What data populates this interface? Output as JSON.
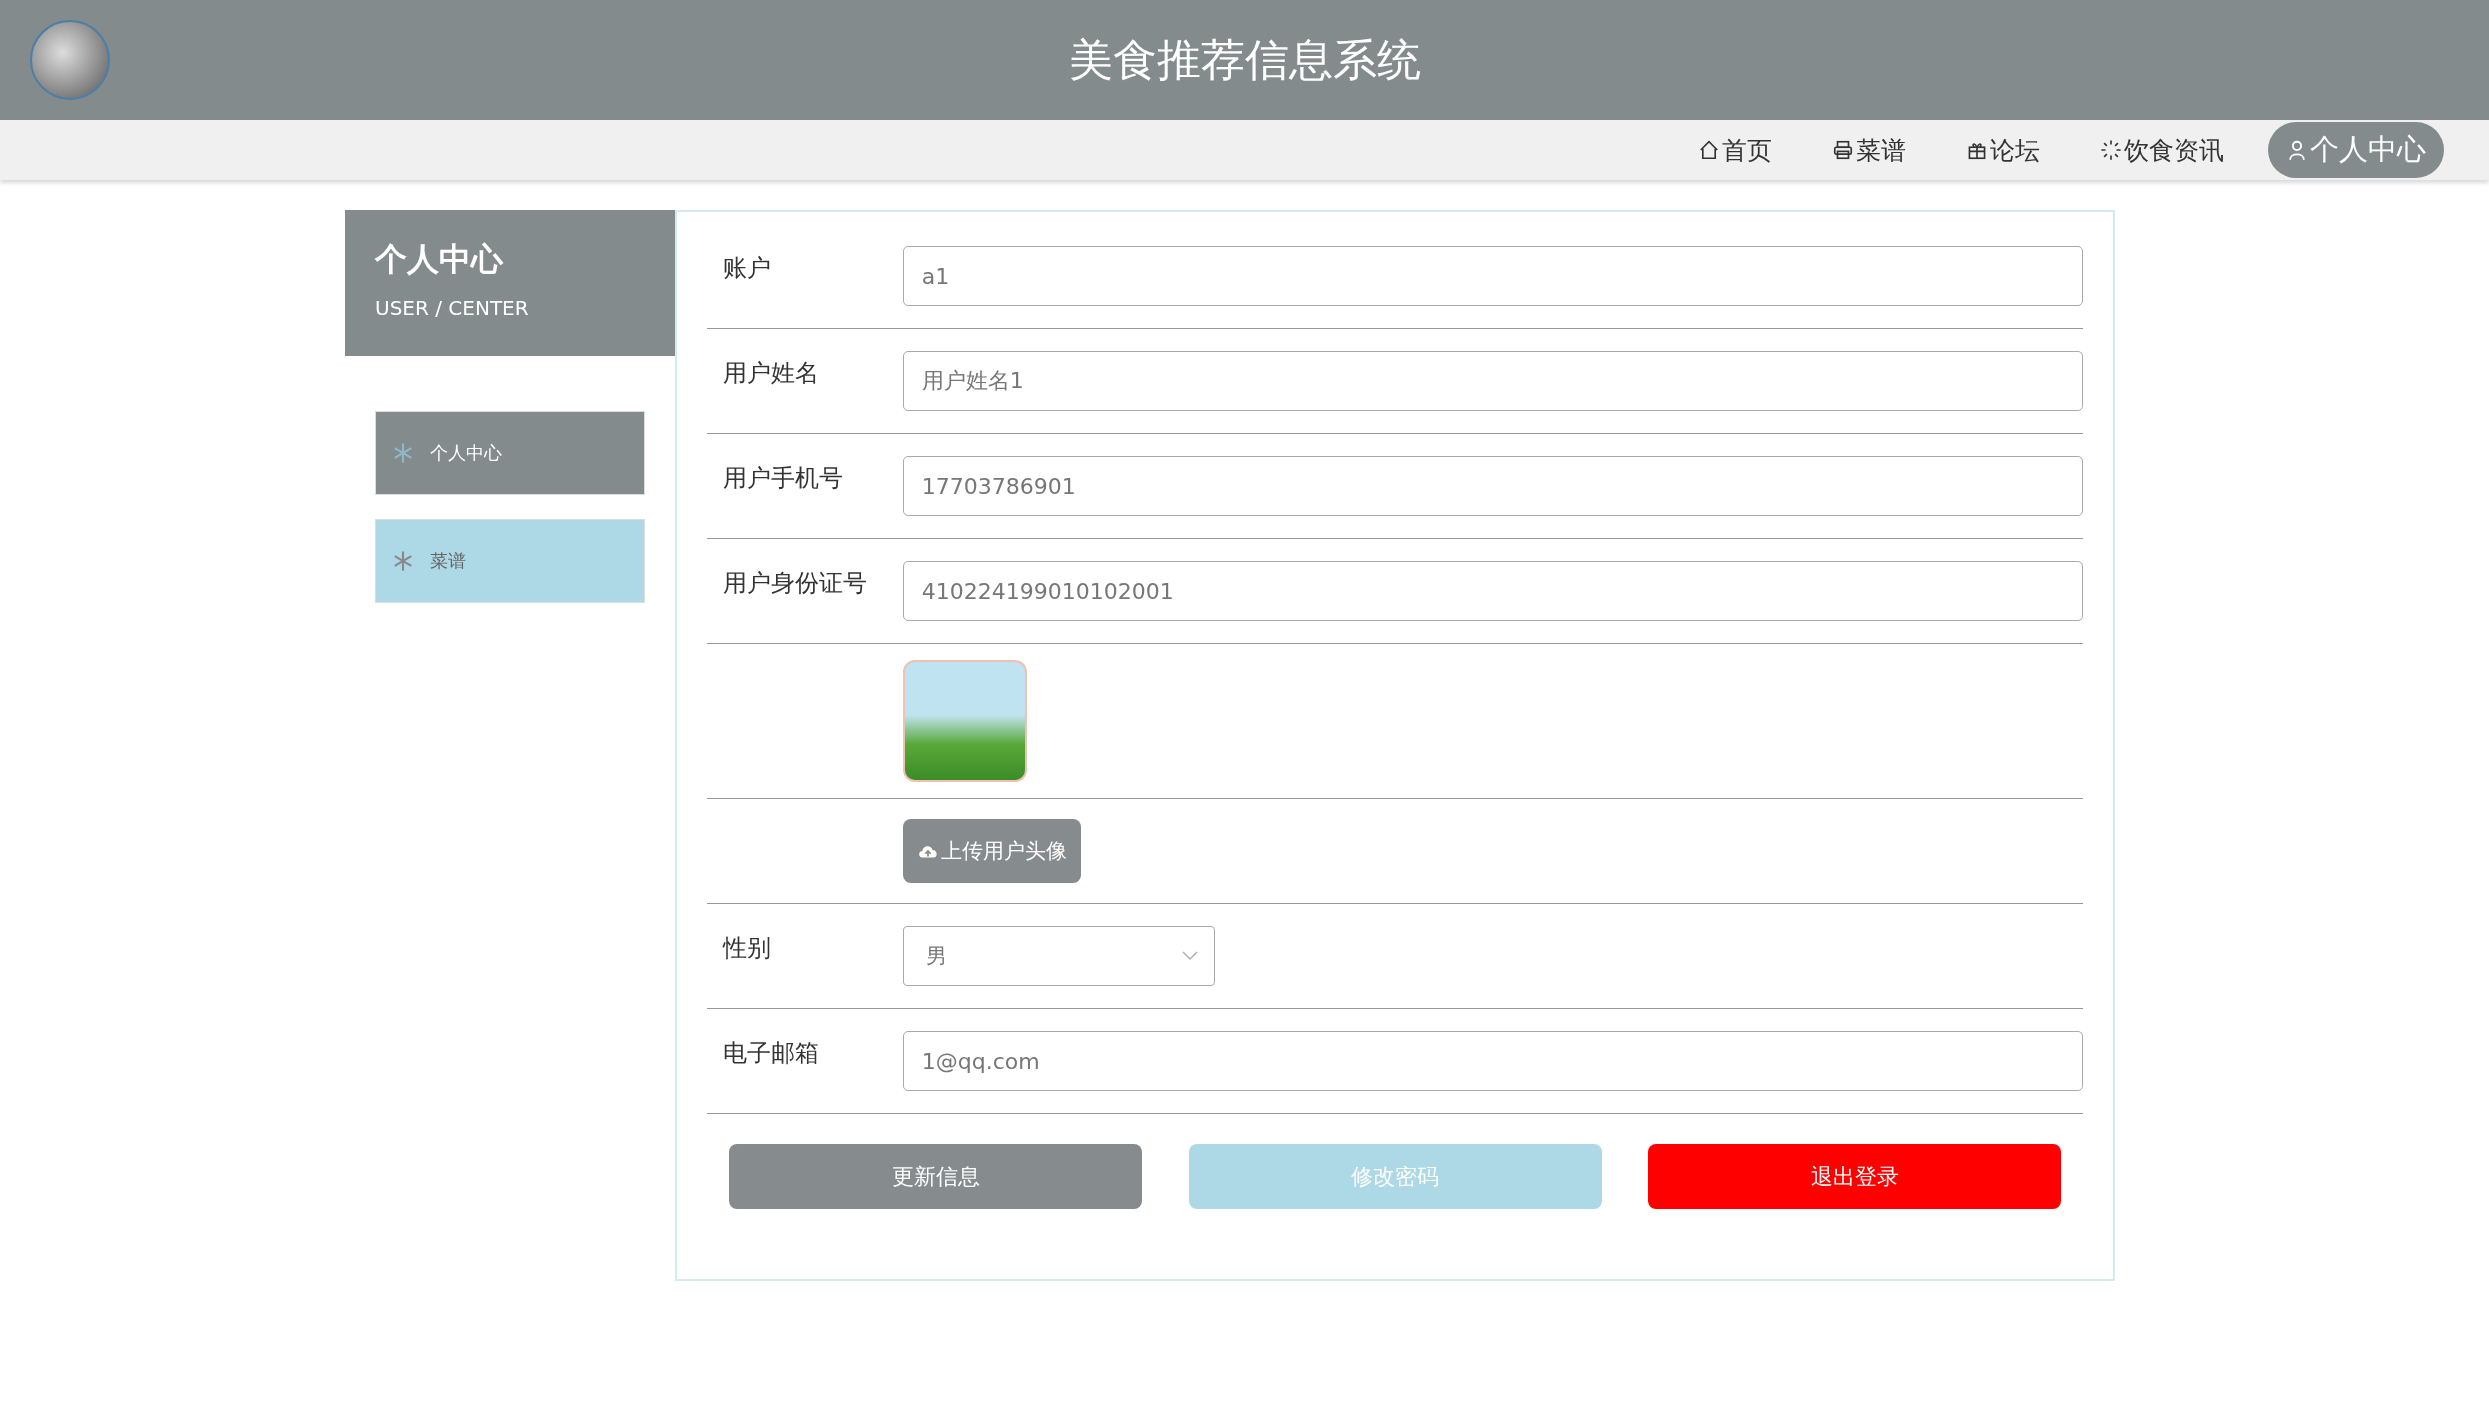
{
  "header": {
    "title": "美食推荐信息系统"
  },
  "nav": [
    {
      "label": "首页",
      "kind": "home",
      "selected": false
    },
    {
      "label": "菜谱",
      "kind": "recipes",
      "selected": false
    },
    {
      "label": "论坛",
      "kind": "forum",
      "selected": false
    },
    {
      "label": "饮食资讯",
      "kind": "news",
      "selected": false
    },
    {
      "label": "个人中心",
      "kind": "profile",
      "selected": true
    }
  ],
  "sidebar": {
    "title": "个人中心",
    "subtitle": "USER / CENTER",
    "items": [
      {
        "label": "个人中心",
        "selected": true
      },
      {
        "label": "菜谱",
        "selected": false
      }
    ]
  },
  "form": {
    "fields": [
      {
        "kind": "text",
        "label": "账户",
        "value": "a1"
      },
      {
        "kind": "text",
        "label": "用户姓名",
        "value": "用户姓名1"
      },
      {
        "kind": "text",
        "label": "用户手机号",
        "value": "17703786901"
      },
      {
        "kind": "text",
        "label": "用户身份证号",
        "value": "410224199010102001"
      },
      {
        "kind": "image"
      },
      {
        "kind": "upload",
        "button": "上传用户头像"
      },
      {
        "kind": "select",
        "label": "性别",
        "value": "男"
      },
      {
        "kind": "text",
        "label": "电子邮箱",
        "value": "1@qq.com"
      }
    ],
    "buttons": [
      {
        "kind": "primary",
        "label": "更新信息"
      },
      {
        "kind": "secondary",
        "label": "修改密码"
      },
      {
        "kind": "danger",
        "label": "退出登录"
      }
    ]
  }
}
